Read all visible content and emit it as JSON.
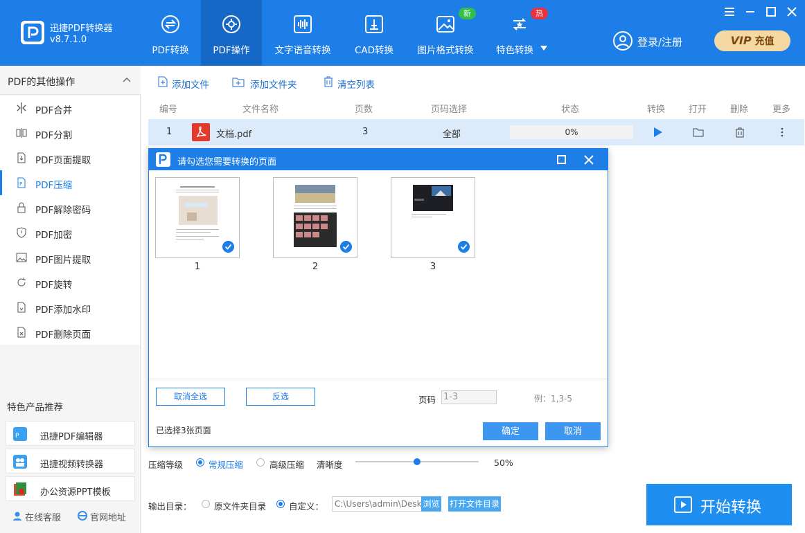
{
  "app": {
    "name": "迅捷PDF转换器",
    "version": "v8.7.1.0"
  },
  "nav": [
    {
      "label": "PDF转换",
      "icon": "exchange-icon",
      "active": false
    },
    {
      "label": "PDF操作",
      "icon": "gear-icon",
      "active": true
    },
    {
      "label": "文字语音转换",
      "icon": "audio-wave-icon",
      "active": false
    },
    {
      "label": "CAD转换",
      "icon": "cad-icon",
      "active": false
    },
    {
      "label": "图片格式转换",
      "icon": "image-icon",
      "active": false,
      "badge": "新"
    },
    {
      "label": "特色转换",
      "icon": "special-convert-icon",
      "active": false,
      "badge": "热"
    }
  ],
  "header": {
    "login": "登录/注册",
    "vip": "VIP",
    "vip_action": "充值"
  },
  "sidebar": {
    "title": "PDF的其他操作",
    "items": [
      {
        "label": "PDF合并",
        "icon": "merge-icon"
      },
      {
        "label": "PDF分割",
        "icon": "split-icon"
      },
      {
        "label": "PDF页面提取",
        "icon": "page-extract-icon"
      },
      {
        "label": "PDF压缩",
        "icon": "compress-icon",
        "active": true
      },
      {
        "label": "PDF解除密码",
        "icon": "unlock-icon"
      },
      {
        "label": "PDF加密",
        "icon": "shield-icon"
      },
      {
        "label": "PDF图片提取",
        "icon": "image-extract-icon"
      },
      {
        "label": "PDF旋转",
        "icon": "rotate-icon"
      },
      {
        "label": "PDF添加水印",
        "icon": "watermark-icon"
      },
      {
        "label": "PDF删除页面",
        "icon": "delete-page-icon"
      }
    ],
    "recommend_title": "特色产品推荐",
    "recommend": [
      {
        "label": "迅捷PDF编辑器",
        "icon": "pdf-editor-icon"
      },
      {
        "label": "迅捷视频转换器",
        "icon": "video-converter-icon"
      },
      {
        "label": "办公资源PPT模板",
        "icon": "ppt-template-icon"
      }
    ],
    "footer": {
      "service": "在线客服",
      "website": "官网地址"
    }
  },
  "toolbar": {
    "add_file": "添加文件",
    "add_folder": "添加文件夹",
    "clear": "清空列表"
  },
  "table": {
    "headers": {
      "no": "编号",
      "name": "文件名称",
      "pages": "页数",
      "range": "页码选择",
      "status": "状态",
      "convert": "转换",
      "open": "打开",
      "delete": "删除",
      "more": "更多"
    },
    "rows": [
      {
        "no": "1",
        "name": "文档.pdf",
        "pages": "3",
        "range": "全部",
        "progress": "0%",
        "progress_value": 0
      }
    ]
  },
  "dialog": {
    "title": "请勾选您需要转换的页面",
    "pages": [
      {
        "no": "1",
        "checked": true
      },
      {
        "no": "2",
        "checked": true
      },
      {
        "no": "3",
        "checked": true
      }
    ],
    "deselect_all": "取消全选",
    "invert": "反选",
    "page_label": "页码",
    "page_value": "1-3",
    "example": "例：1,3-5",
    "selected_info": "已选择3张页面",
    "ok": "确定",
    "cancel": "取消"
  },
  "compress": {
    "level_label": "压缩等级",
    "normal": "常规压缩",
    "high": "高级压缩",
    "clarity_label": "清晰度",
    "clarity_value": "50%",
    "clarity_fraction": 0.5
  },
  "output": {
    "label": "输出目录：",
    "original": "原文件夹目录",
    "custom": "自定义：",
    "path": "C:\\Users\\admin\\Desktop",
    "browse": "浏览",
    "open_dir": "打开文件目录"
  },
  "start": "开始转换",
  "colors": {
    "primary": "#1e7ee8",
    "primary_dark": "#1668c6",
    "badge_new": "#2fbf4a",
    "badge_hot": "#e8323c",
    "vip_bg": "#f3d8a3"
  }
}
